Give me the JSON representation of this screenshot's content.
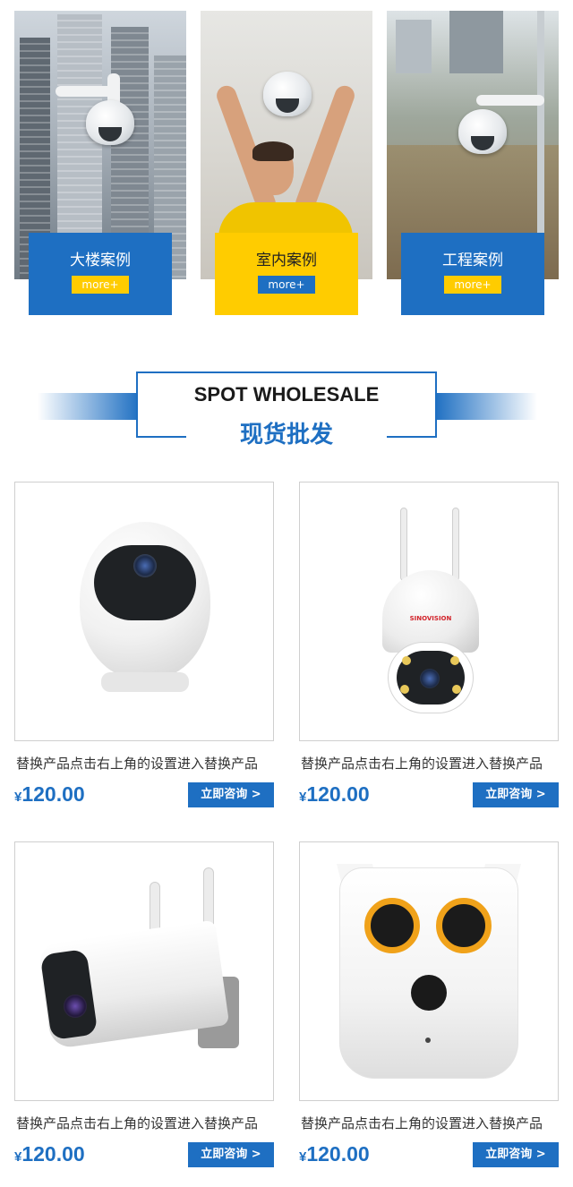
{
  "cases": [
    {
      "title": "大楼案例",
      "more": "more+"
    },
    {
      "title": "室内案例",
      "more": "more+"
    },
    {
      "title": "工程案例",
      "more": "more+"
    }
  ],
  "section": {
    "title_en": "SPOT WHOLESALE",
    "title_cn": "现货批发"
  },
  "products": [
    {
      "name": "替换产品点击右上角的设置进入替换产品",
      "currency": "¥",
      "price": "120.00",
      "button": "立即咨询 >"
    },
    {
      "name": "替换产品点击右上角的设置进入替换产品",
      "currency": "¥",
      "price": "120.00",
      "button": "立即咨询 >"
    },
    {
      "name": "替换产品点击右上角的设置进入替换产品",
      "currency": "¥",
      "price": "120.00",
      "button": "立即咨询 >"
    },
    {
      "name": "替换产品点击右上角的设置进入替换产品",
      "currency": "¥",
      "price": "120.00",
      "button": "立即咨询 >"
    }
  ],
  "product_images": [
    "egg-camera",
    "ptz-dome-camera",
    "bullet-camera",
    "owl-camera"
  ],
  "brand_text": "SINOVISION",
  "colors": {
    "accent_blue": "#1e6fc2",
    "accent_yellow": "#ffcc00"
  }
}
